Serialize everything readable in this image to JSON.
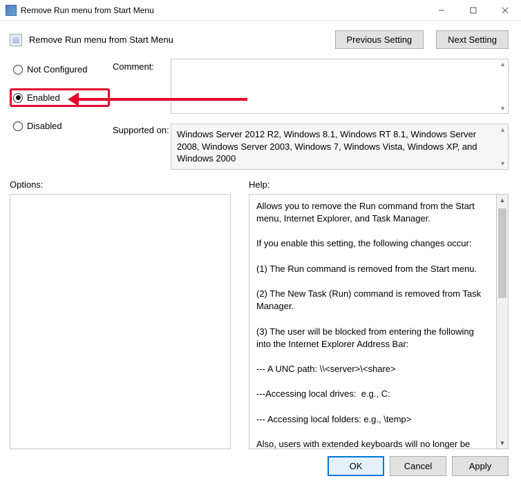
{
  "window": {
    "title": "Remove Run menu from Start Menu"
  },
  "header": {
    "policy_title": "Remove Run menu from Start Menu",
    "previous_setting": "Previous Setting",
    "next_setting": "Next Setting"
  },
  "state": {
    "options": [
      {
        "label": "Not Configured",
        "checked": false,
        "highlight": false
      },
      {
        "label": "Enabled",
        "checked": true,
        "highlight": true
      },
      {
        "label": "Disabled",
        "checked": false,
        "highlight": false
      }
    ],
    "comment_label": "Comment:",
    "comment_value": "",
    "supported_label": "Supported on:",
    "supported_text": "Windows Server 2012 R2, Windows 8.1, Windows RT 8.1, Windows Server 2008, Windows Server 2003, Windows 7, Windows Vista, Windows XP, and Windows 2000"
  },
  "sections": {
    "options_label": "Options:",
    "help_label": "Help:",
    "help_text": "Allows you to remove the Run command from the Start menu, Internet Explorer, and Task Manager.\n\nIf you enable this setting, the following changes occur:\n\n(1) The Run command is removed from the Start menu.\n\n(2) The New Task (Run) command is removed from Task Manager.\n\n(3) The user will be blocked from entering the following into the Internet Explorer Address Bar:\n\n--- A UNC path: \\\\<server>\\<share>\n\n---Accessing local drives:  e.g., C:\n\n--- Accessing local folders: e.g., \\temp>\n\nAlso, users with extended keyboards will no longer be able to display the Run dialog box by pressing the Application key (the"
  },
  "footer": {
    "ok": "OK",
    "cancel": "Cancel",
    "apply": "Apply"
  }
}
